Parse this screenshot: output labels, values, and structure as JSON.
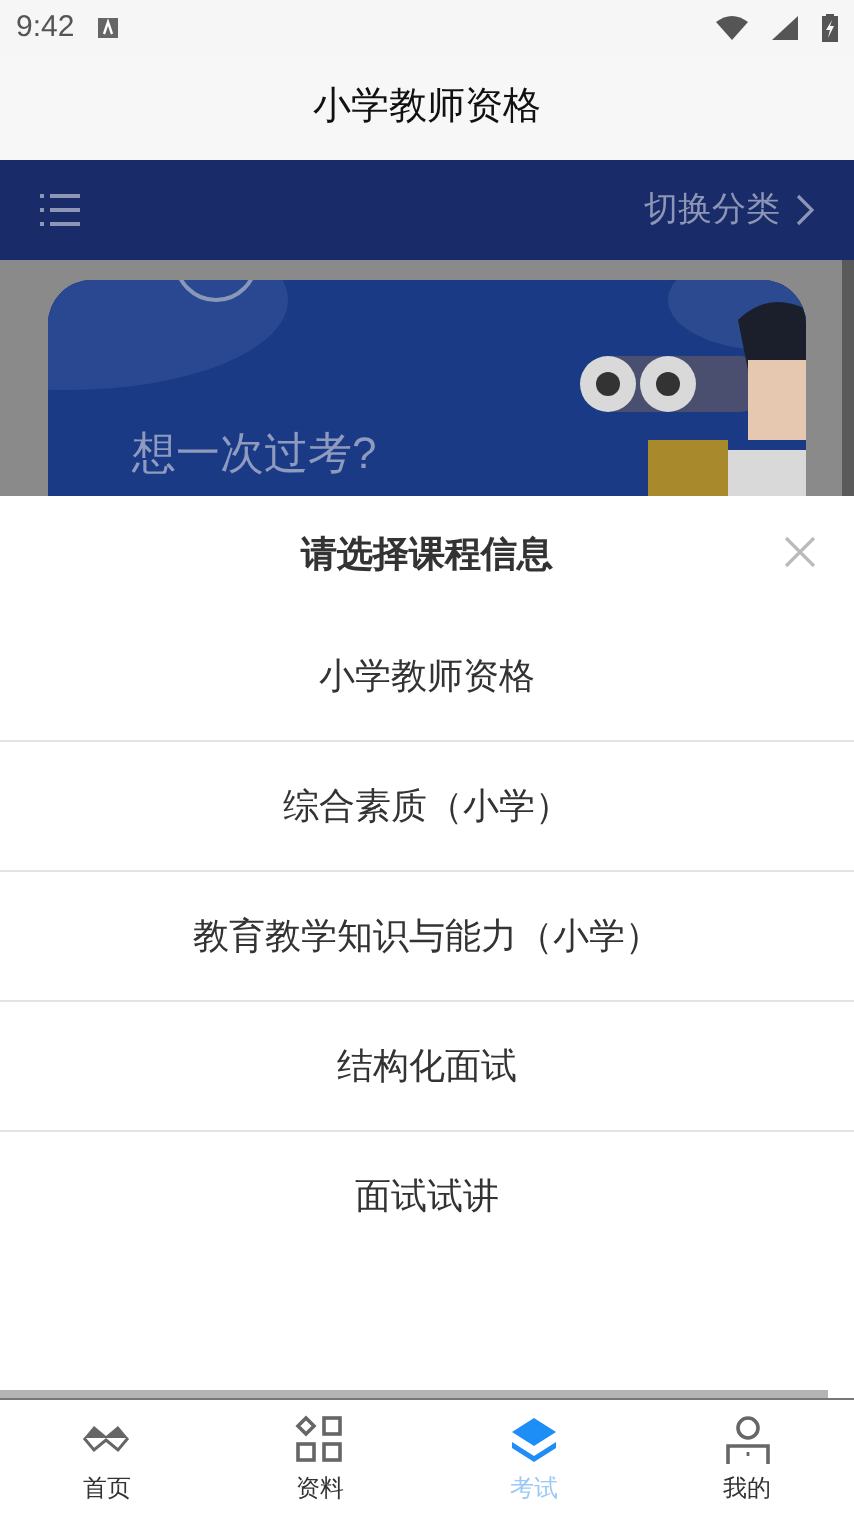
{
  "status_bar": {
    "time": "9:42"
  },
  "header": {
    "title": "小学教师资格"
  },
  "toolbar": {
    "switch_label": "切换分类"
  },
  "banner": {
    "headline": "想一次过考?"
  },
  "sheet": {
    "title": "请选择课程信息",
    "options": [
      {
        "label": "小学教师资格"
      },
      {
        "label": "综合素质（小学）"
      },
      {
        "label": "教育教学知识与能力（小学）"
      },
      {
        "label": "结构化面试"
      },
      {
        "label": "面试试讲"
      }
    ]
  },
  "bottom_nav": [
    {
      "label": "首页",
      "kind": "home",
      "selected": false
    },
    {
      "label": "资料",
      "kind": "grid",
      "selected": false
    },
    {
      "label": "考试",
      "kind": "layers",
      "selected": true
    },
    {
      "label": "我的",
      "kind": "person",
      "selected": false
    }
  ]
}
